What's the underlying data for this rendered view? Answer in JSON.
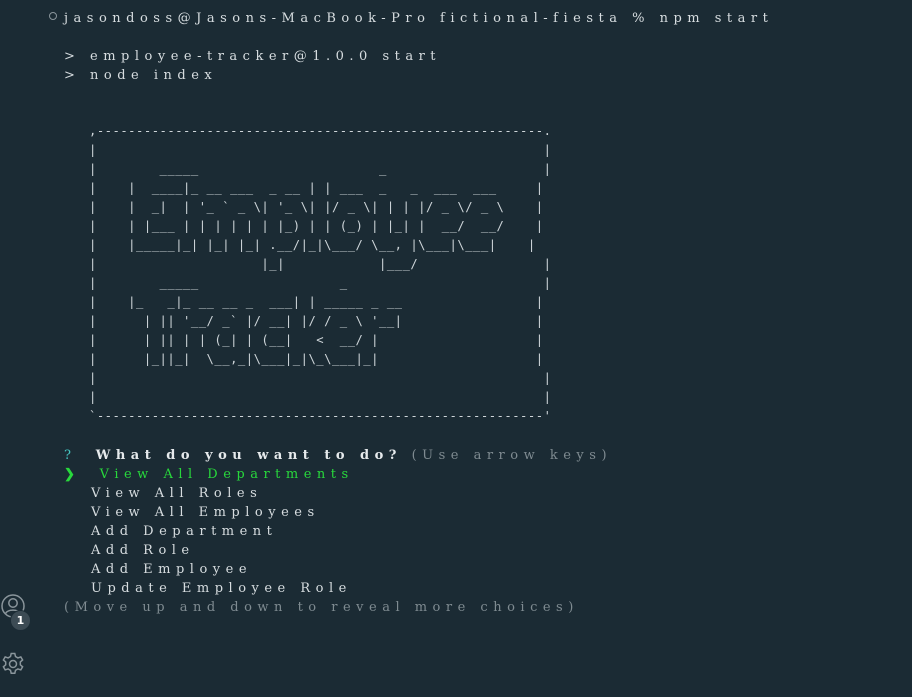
{
  "terminal": {
    "command_line": "jasondoss@Jasons-MacBook-Pro fictional-fiesta % npm start",
    "npm_output": [
      "> employee-tracker@1.0.0 start",
      "> node index"
    ],
    "banner": ",---------------------------------------------------------.\n|                                                         |\n|        _____                       _                    |\n|    |  ____|_ __ ___  _ __ | | ___  _   _  ___  ___     |\n|    |  _|  | '_ ` _ \\| '_ \\| |/ _ \\| | | |/ _ \\/ _ \\    |\n|    | |___ | | | | | | |_) | | (_) | |_| |  __/  __/    |\n|    |_____|_| |_| |_| .__/|_|\\___/ \\__, |\\___|\\___|    |\n|                     |_|            |___/                |\n|        _____                  _                         |\n|    |_   _|_ __ __ _  ___| | _____ _ __                 |\n|      | || '__/ _` |/ __| |/ / _ \\ '__|                 |\n|      | || | | (_| | (__|   <  __/ |                    |\n|      |_||_|  \\__,_|\\___|_|\\_\\___|_|                    |\n|                                                         |\n|                                                         |\n`---------------------------------------------------------'",
    "question_mark": "?",
    "question": "What do you want to do?",
    "hint": "(Use arrow keys)",
    "pointer": "❯",
    "choices": [
      "View All Departments",
      "View All Roles",
      "View All Employees",
      "Add Department",
      "Add Role",
      "Add Employee",
      "Update Employee Role"
    ],
    "more_hint": "(Move up and down to reveal more choices)"
  },
  "sidebar": {
    "accounts_icon": "account-icon",
    "accounts_badge": "1",
    "settings_icon": "gear-icon"
  },
  "colors": {
    "background": "#1b2b34",
    "selected": "#28d83c",
    "question_mark": "#45c4bf",
    "dim": "#7f8b91"
  }
}
